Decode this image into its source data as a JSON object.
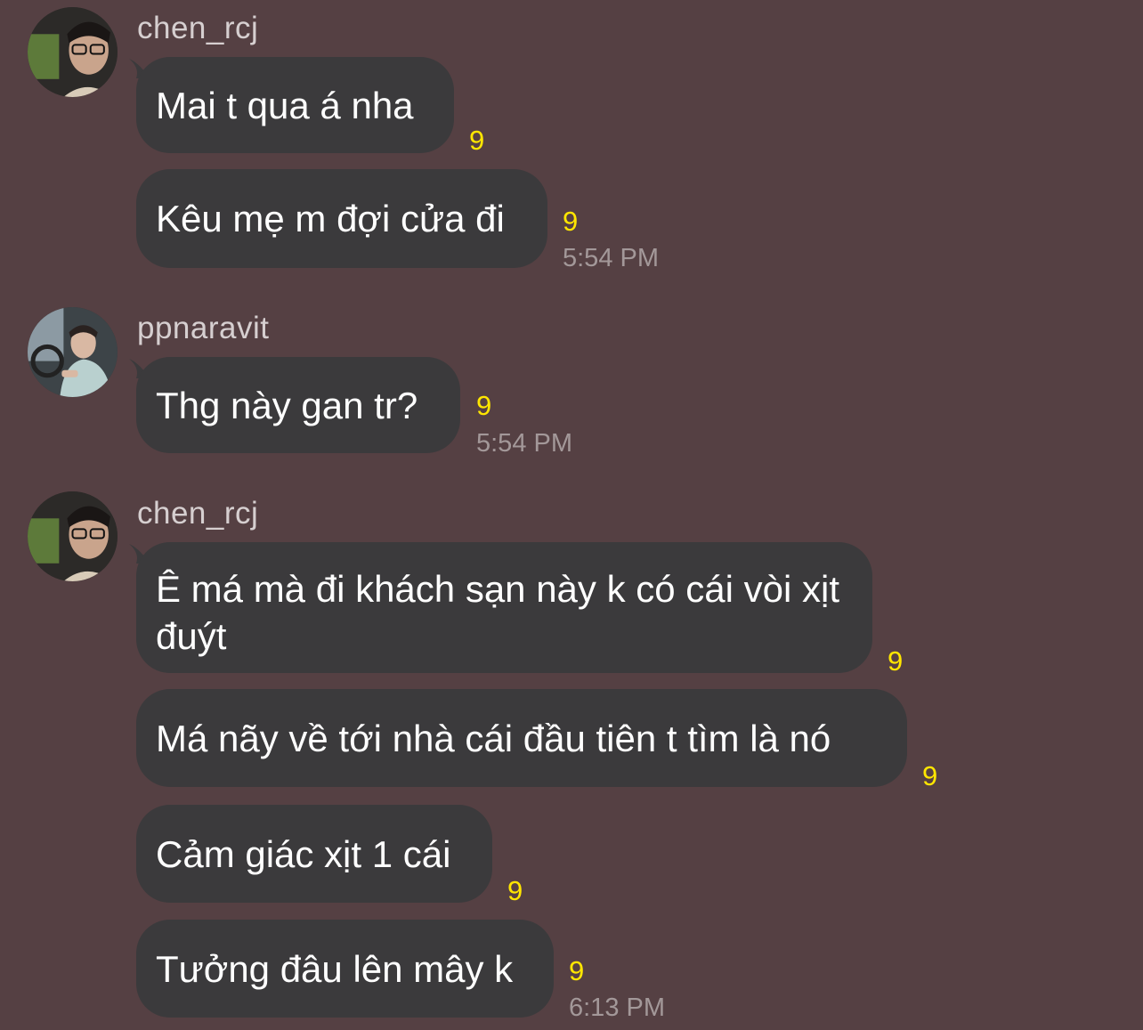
{
  "colors": {
    "background": "#554043",
    "bubble": "#3b3a3c",
    "read_marker": "#ffe600",
    "timestamp": "#a39899",
    "username": "#d6cfd0"
  },
  "groups": [
    {
      "user": "chen_rcj",
      "avatar": "profile-photo",
      "messages": [
        {
          "text": "Mai t qua á nha",
          "read": "9"
        },
        {
          "text": "Kêu mẹ m đợi cửa đi",
          "read": "9",
          "time": "5:54 PM"
        }
      ]
    },
    {
      "user": "ppnaravit",
      "avatar": "profile-photo",
      "messages": [
        {
          "text": "Thg này gan tr?",
          "read": "9",
          "time": "5:54 PM"
        }
      ]
    },
    {
      "user": "chen_rcj",
      "avatar": "profile-photo",
      "messages": [
        {
          "text": "Ê má mà đi khách sạn này k có cái vòi xịt đuýt",
          "read": "9"
        },
        {
          "text": "Má nãy về tới nhà cái đầu tiên t tìm là nó",
          "read": "9"
        },
        {
          "text": "Cảm giác xịt 1 cái",
          "read": "9"
        },
        {
          "text": "Tưởng đâu lên mây k",
          "read": "9",
          "time": "6:13 PM"
        }
      ]
    }
  ]
}
